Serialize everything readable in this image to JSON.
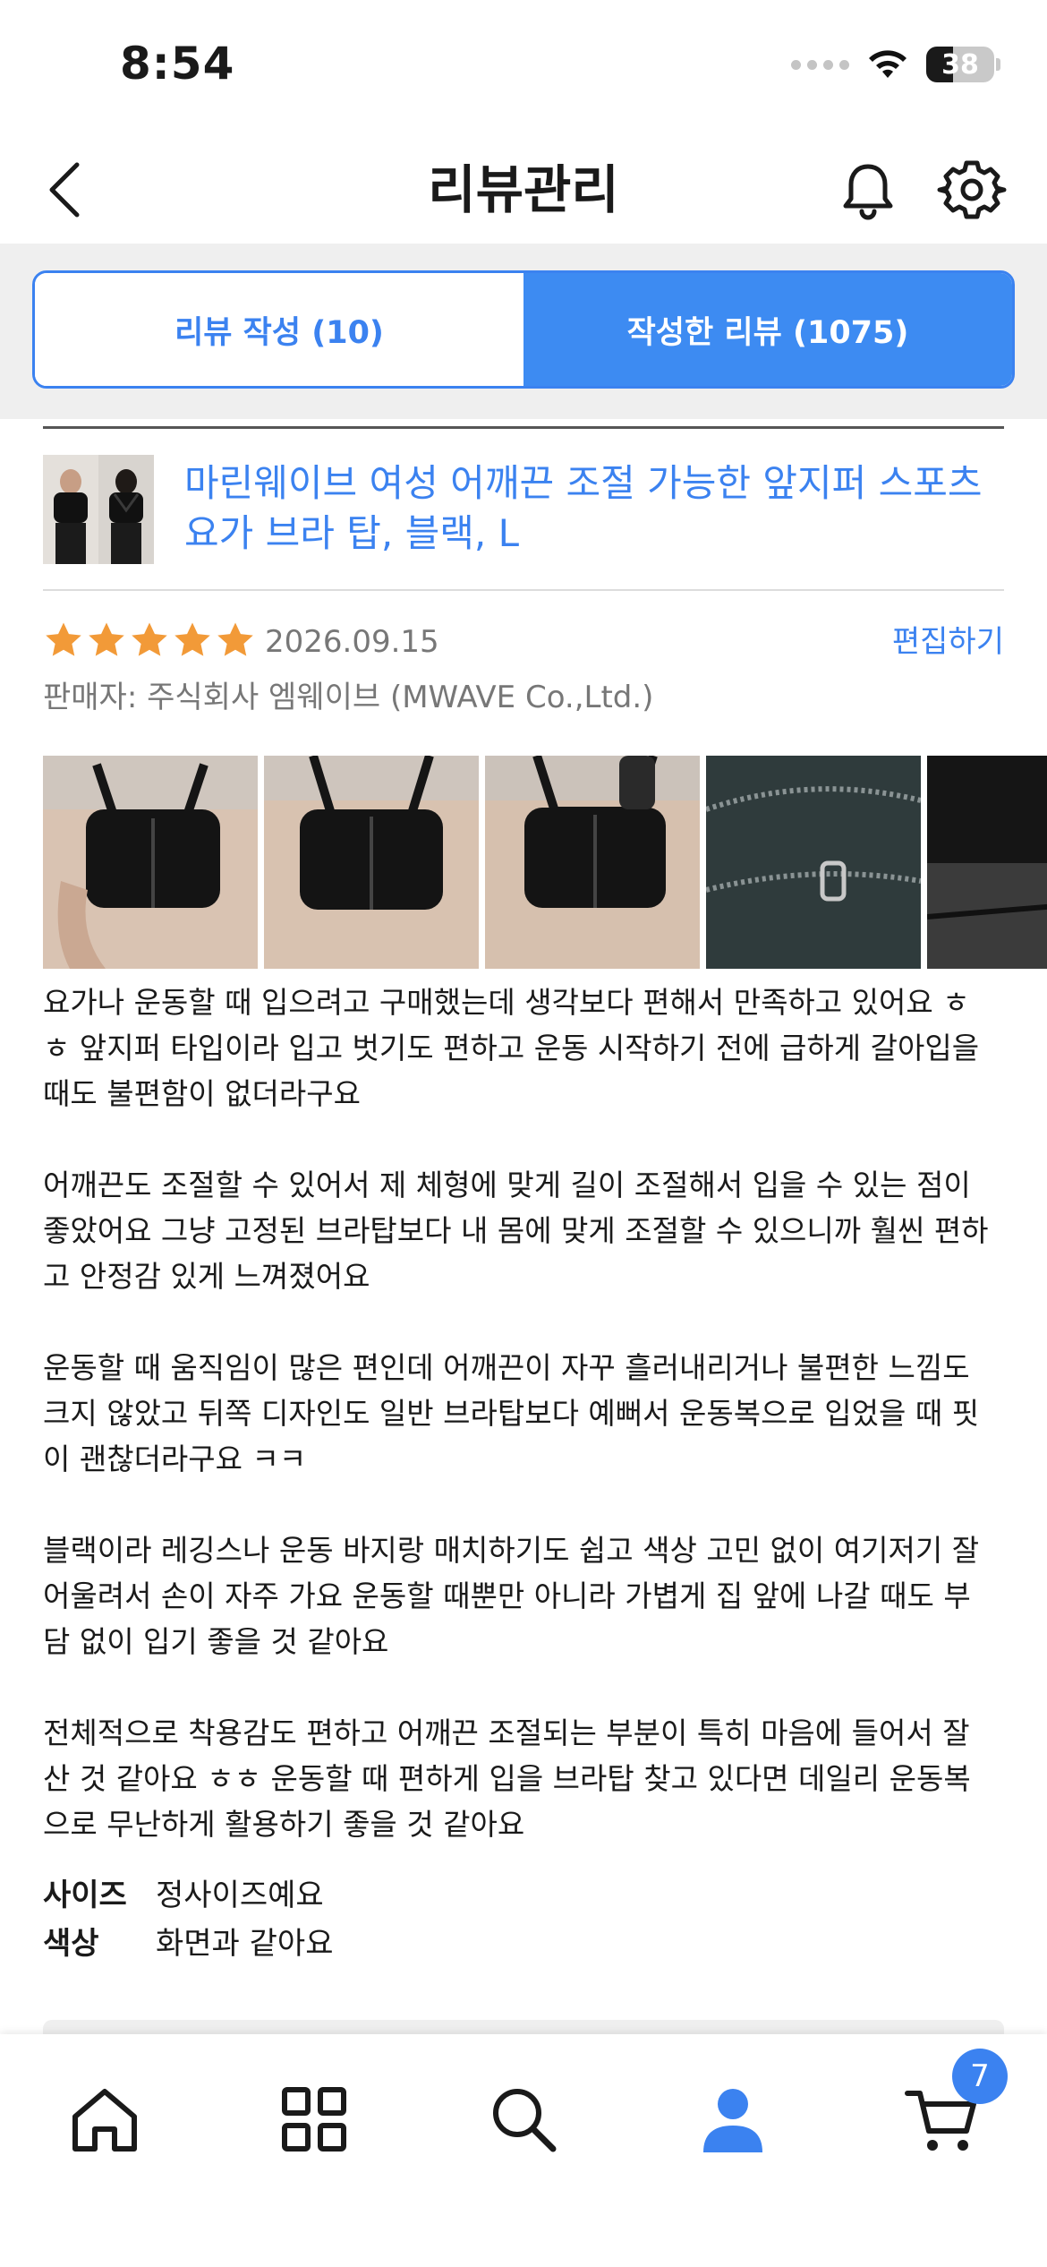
{
  "status_bar": {
    "time": "8:54",
    "battery": "38"
  },
  "nav": {
    "title": "리뷰관리"
  },
  "tabs": [
    {
      "label": "리뷰 작성 (10)",
      "active": false
    },
    {
      "label": "작성한 리뷰 (1075)",
      "active": true
    }
  ],
  "review": {
    "product_title": "마린웨이브 여성 어깨끈 조절 가능한 앞지퍼 스포츠 요가 브라 탑, 블랙, L",
    "rating": 5,
    "date": "2026.09.15",
    "edit_label": "편집하기",
    "seller": "판매자: 주식회사 엠웨이브 (MWAVE Co.,Ltd.)",
    "paragraphs": [
      "요가나 운동할 때 입으려고 구매했는데 생각보다 편해서 만족하고 있어요 ㅎ\nㅎ 앞지퍼 타입이라 입고 벗기도 편하고 운동 시작하기 전에 급하게 갈아입을\n때도 불편함이 없더라구요",
      "어깨끈도 조절할 수 있어서 제 체형에 맞게 길이 조절해서 입을 수 있는 점이\n좋았어요 그냥 고정된 브라탑보다 내 몸에 맞게 조절할 수 있으니까 훨씬 편하\n고 안정감 있게 느껴졌어요",
      "운동할 때 움직임이 많은 편인데 어깨끈이 자꾸 흘러내리거나 불편한 느낌도\n크지 않았고 뒤쪽 디자인도 일반 브라탑보다 예뻐서 운동복으로 입었을 때 핏\n이 괜찮더라구요 ㅋㅋ",
      "블랙이라 레깅스나 운동 바지랑 매치하기도 쉽고 색상 고민 없이 여기저기 잘\n어울려서 손이 자주 가요 운동할 때뿐만 아니라 가볍게 집 앞에 나갈 때도 부\n담 없이 입기 좋을 것 같아요",
      "전체적으로 착용감도 편하고 어깨끈 조절되는 부분이 특히 마음에 들어서 잘\n산 것 같아요 ㅎㅎ 운동할 때 편하게 입을 브라탑 찾고 있다면 데일리 운동복\n으로 무난하게 활용하기 좋을 것 같아요"
    ],
    "attributes": [
      {
        "key": "사이즈",
        "value": "정사이즈예요"
      },
      {
        "key": "색상",
        "value": "화면과 같아요"
      }
    ]
  },
  "tabbar": {
    "items": [
      "home-icon",
      "grid-icon",
      "search-icon",
      "profile-icon",
      "cart-icon"
    ],
    "active": "profile-icon",
    "cart_badge": "7"
  },
  "colors": {
    "accent": "#3b82f0",
    "star": "#f29a38",
    "muted": "#777777"
  }
}
